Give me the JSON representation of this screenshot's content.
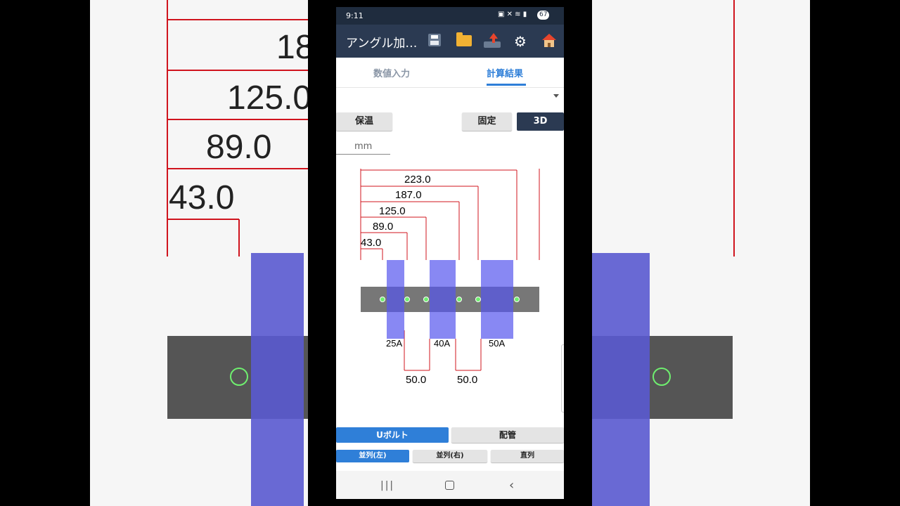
{
  "status_bar": {
    "time": "9:11",
    "battery": "67"
  },
  "app_bar": {
    "title": "アングル加…"
  },
  "tabs": [
    {
      "label": "数値入力"
    },
    {
      "label": "計算結果"
    }
  ],
  "toolbar": {
    "insulation_button": "保温",
    "fixed_button": "固定",
    "three_d_button": "3D",
    "unit_label": "mm"
  },
  "drawing": {
    "top_dimensions": [
      "223.0",
      "187.0",
      "125.0",
      "89.0",
      "43.0"
    ],
    "pipes": [
      "25A",
      "40A",
      "50A"
    ],
    "bottom_dimensions": [
      "50.0",
      "50.0"
    ]
  },
  "bottom_controls": {
    "ubolt_button": "Uボルト",
    "piping_button": "配管",
    "parallel_left": "並列(左)",
    "parallel_right": "並列(右)",
    "series": "直列"
  },
  "background_zoom": {
    "dimensions": [
      "18",
      "125.0",
      "89.0",
      "43.0"
    ]
  },
  "colors": {
    "accent": "#2f7fd8",
    "dark": "#2b3a52",
    "dimension_line": "#d0141e",
    "pipe": "#6f6ff2",
    "angle_bar": "#777777",
    "bolt_hole": "#6fef6f"
  }
}
